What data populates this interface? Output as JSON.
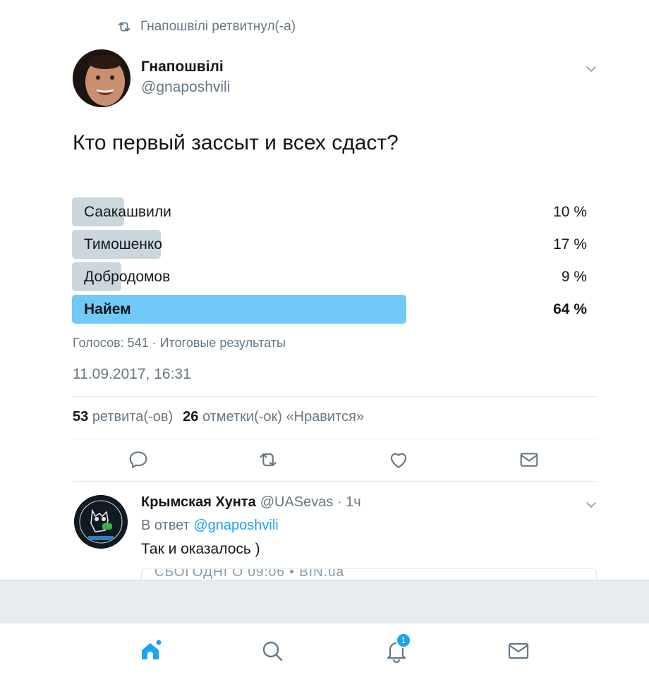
{
  "retweet_context": {
    "label": "Гнапошвілі ретвитнул(-а)",
    "icon": "retweet-icon"
  },
  "tweet": {
    "author_name": "Гнапошвілі",
    "author_handle": "@gnaposhvili",
    "text": "Кто первый зассыт и всех сдаст?",
    "poll": {
      "options": [
        {
          "label": "Саакашвили",
          "percent_label": "10 %",
          "percent": 10,
          "winner": false
        },
        {
          "label": "Тимошенко",
          "percent_label": "17 %",
          "percent": 17,
          "winner": false
        },
        {
          "label": "Добродомов",
          "percent_label": "9 %",
          "percent": 9,
          "winner": false
        },
        {
          "label": "Найем",
          "percent_label": "64 %",
          "percent": 64,
          "winner": true
        }
      ],
      "summary": "Голосов: 541 · Итоговые результаты"
    },
    "timestamp": "11.09.2017, 16:31",
    "stats": {
      "retweets_count": "53",
      "retweets_label": "ретвита(-ов)",
      "likes_count": "26",
      "likes_label": "отметки(-ок) «Нравится»"
    },
    "actions": [
      "reply-icon",
      "retweet-icon",
      "heart-icon",
      "envelope-icon"
    ]
  },
  "reply": {
    "author_name": "Крымская Хунта",
    "author_meta": "@UASevas · 1ч",
    "reply_prefix": "В ответ",
    "reply_mention": "@gnaposhvili",
    "text": "Так и оказалось )",
    "cutoff_text": "СЬОГОДНІ О 09:06 • BIN.ua"
  },
  "tabbar": {
    "items": [
      "home-icon",
      "search-icon",
      "notifications-icon",
      "messages-icon"
    ],
    "notification_badge": "1"
  },
  "colors": {
    "accent": "#1da1f2",
    "poll_winner": "#71c9f8",
    "poll_bar": "#ccd6dd",
    "secondary_text": "#657786"
  }
}
